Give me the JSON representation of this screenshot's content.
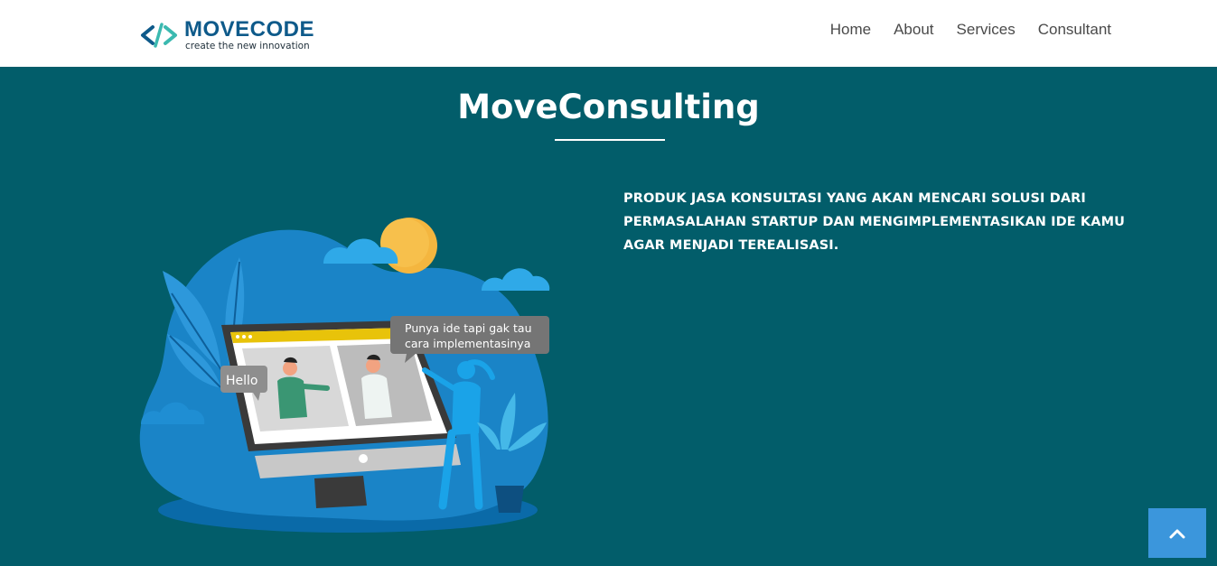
{
  "brand": {
    "name": "MOVECODE",
    "tagline": "create the new innovation"
  },
  "nav": {
    "items": [
      {
        "label": "Home"
      },
      {
        "label": "About"
      },
      {
        "label": "Services"
      },
      {
        "label": "Consultant"
      }
    ]
  },
  "hero": {
    "title": "MoveConsulting",
    "description": "PRODUK JASA KONSULTASI YANG AKAN MENCARI SOLUSI DARI PERMASALAHAN STARTUP DAN MENGIMPLEMENTASIKAN IDE KAMU AGAR MENJADI TEREALISASI."
  },
  "illustration": {
    "bubble_left": "Hello",
    "bubble_right_line1": "Punya ide tapi gak tau",
    "bubble_right_line2": "cara implementasinya"
  },
  "back_to_top": {
    "icon": "chevron-up-icon"
  },
  "colors": {
    "hero_background": "#025d6a",
    "navbar_background": "#ffffff",
    "brand_blue": "#0e5a8a",
    "brand_teal": "#3bb9b0",
    "back_to_top": "#3b96dc"
  }
}
